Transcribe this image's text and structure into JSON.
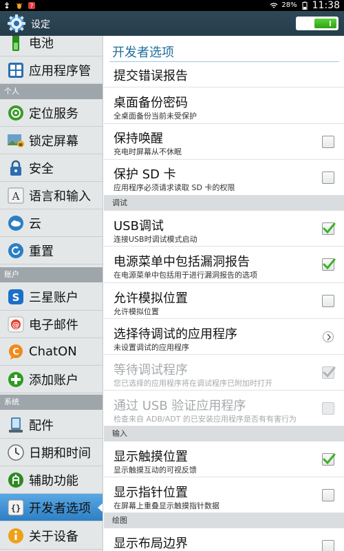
{
  "status_bar": {
    "battery": "28%",
    "time": "11:38"
  },
  "title_bar": {
    "title": "设定"
  },
  "sidebar": {
    "items": [
      {
        "label": "电池",
        "icon": "battery-icon"
      },
      {
        "label": "应用程序管",
        "icon": "apps-icon"
      },
      {
        "header": "个人"
      },
      {
        "label": "定位服务",
        "icon": "location-icon"
      },
      {
        "label": "锁定屏幕",
        "icon": "lock-screen-icon"
      },
      {
        "label": "安全",
        "icon": "padlock-icon"
      },
      {
        "label": "语言和输入",
        "icon": "language-icon"
      },
      {
        "label": "云",
        "icon": "cloud-icon"
      },
      {
        "label": "重置",
        "icon": "reset-icon"
      },
      {
        "header": "账户"
      },
      {
        "label": "三星账户",
        "icon": "samsung-account-icon"
      },
      {
        "label": "电子邮件",
        "icon": "email-icon"
      },
      {
        "label": "ChatON",
        "icon": "chaton-icon"
      },
      {
        "label": "添加账户",
        "icon": "add-account-icon"
      },
      {
        "header": "系统"
      },
      {
        "label": "配件",
        "icon": "accessory-icon"
      },
      {
        "label": "日期和时间",
        "icon": "clock-icon"
      },
      {
        "label": "辅助功能",
        "icon": "accessibility-icon"
      },
      {
        "label": "开发者选项",
        "icon": "developer-braces-icon",
        "selected": true
      },
      {
        "label": "关于设备",
        "icon": "info-icon"
      }
    ]
  },
  "content": {
    "title": "开发者选项",
    "rows": [
      {
        "title": "提交错误报告",
        "control": "none"
      },
      {
        "title": "桌面备份密码",
        "subtitle": "全桌面备份当前未受保护",
        "control": "none"
      },
      {
        "title": "保持唤醒",
        "subtitle": "充电时屏幕从不休眠",
        "control": "checkbox",
        "checked": false
      },
      {
        "title": "保护 SD 卡",
        "subtitle": "应用程序必须请求读取 SD 卡的权限",
        "control": "checkbox",
        "checked": false
      },
      {
        "section": "调试"
      },
      {
        "title": "USB调试",
        "subtitle": "连接USB时调试模式启动",
        "control": "checkbox",
        "checked": true
      },
      {
        "title": "电源菜单中包括漏洞报告",
        "subtitle": "在电源菜单中包括用于进行漏洞报告的选项",
        "control": "checkbox",
        "checked": true
      },
      {
        "title": "允许模拟位置",
        "subtitle": "允许模拟位置",
        "control": "checkbox",
        "checked": false
      },
      {
        "title": "选择待调试的应用程序",
        "subtitle": "未设置调试的应用程序",
        "control": "chevron"
      },
      {
        "title": "等待调试程序",
        "subtitle": "您已选择的应用程序将在调试程序已附加时打开",
        "control": "checkbox",
        "checked": true,
        "disabled": true
      },
      {
        "title": "通过 USB 验证应用程序",
        "subtitle": "检查来自 ADB/ADT 的已安装应用程序是否有有害行为",
        "control": "checkbox",
        "checked": false,
        "disabled": true
      },
      {
        "section": "输入"
      },
      {
        "title": "显示触摸位置",
        "subtitle": "显示触摸互动的可视反馈",
        "control": "checkbox",
        "checked": true
      },
      {
        "title": "显示指针位置",
        "subtitle": "在屏幕上重叠显示触摸指针数据",
        "control": "checkbox",
        "checked": false
      },
      {
        "section": "绘图"
      },
      {
        "title": "显示布局边界",
        "control": "checkbox",
        "checked": false
      }
    ]
  },
  "colors": {
    "accent": "#2d7fc4",
    "check_green": "#3bb223",
    "title_blue": "#1e6e9c"
  }
}
